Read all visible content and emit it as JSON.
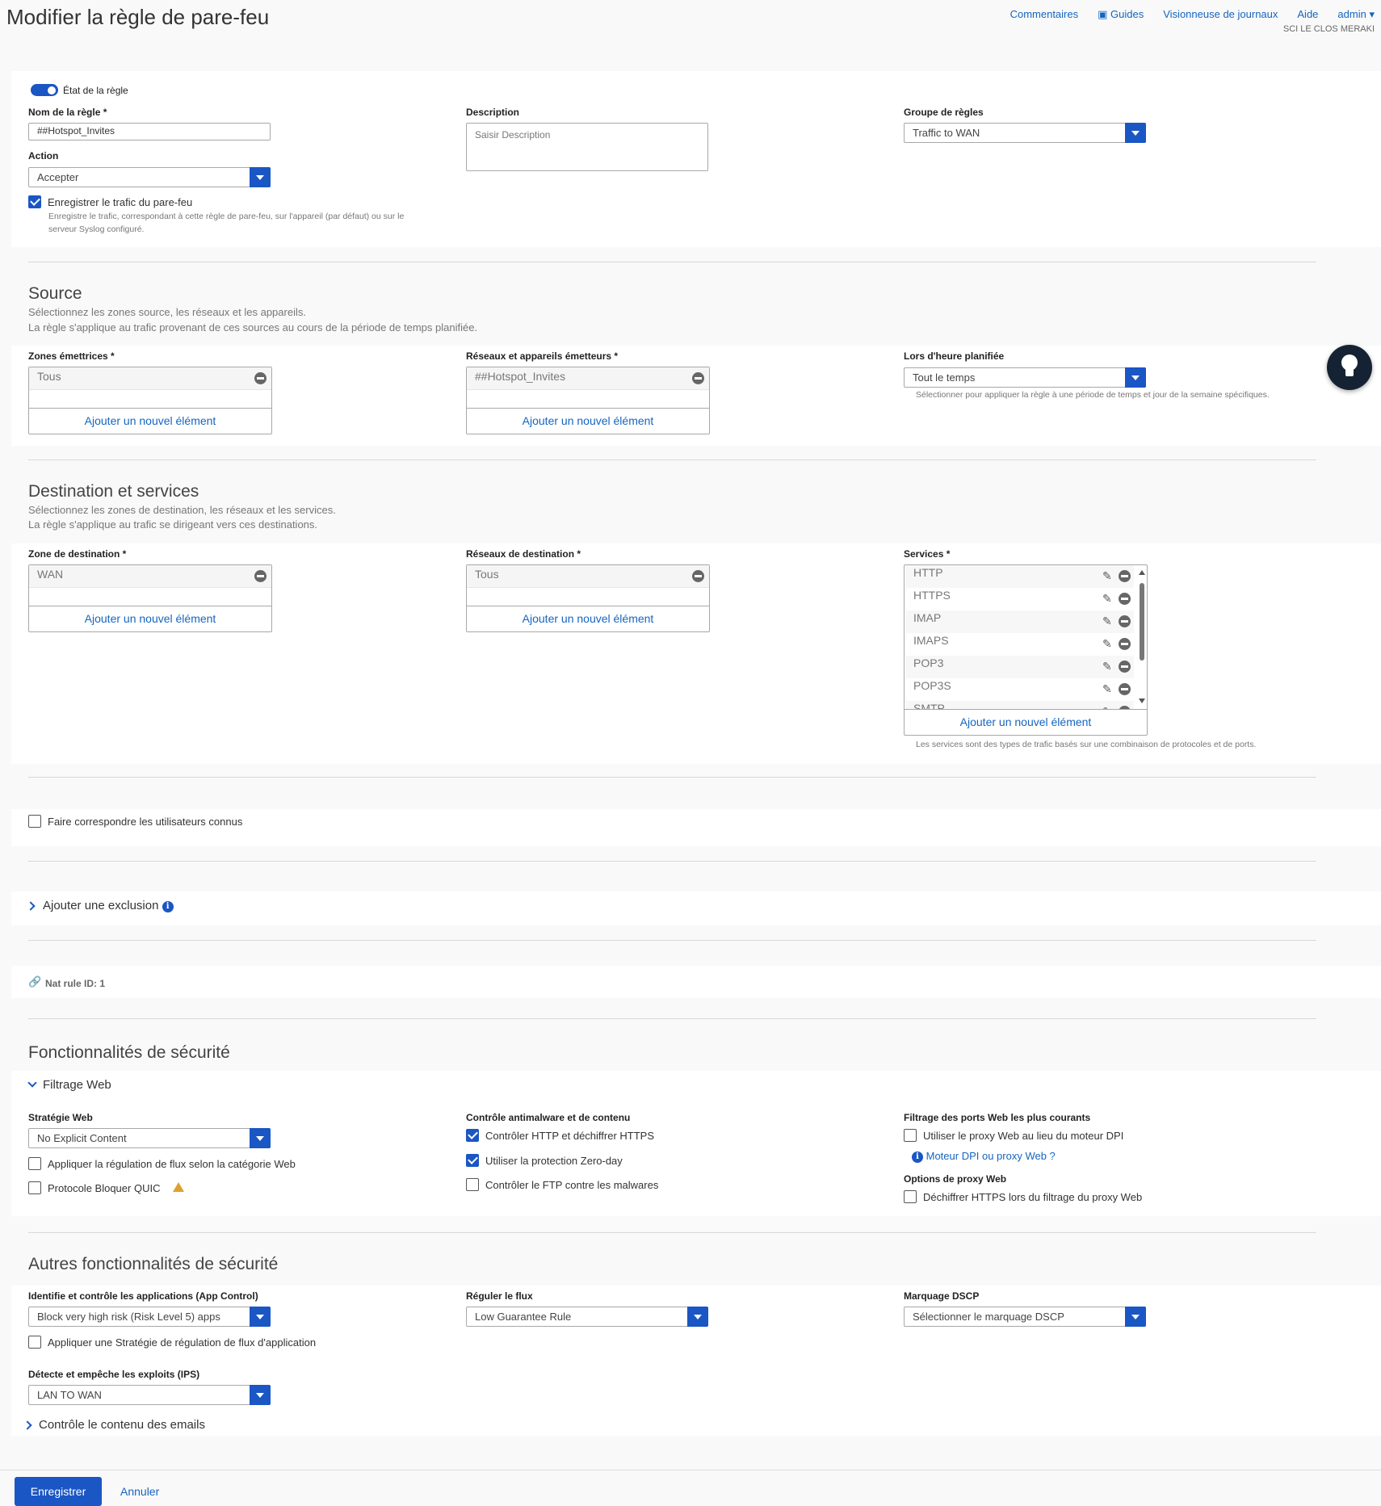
{
  "page": {
    "title": "Modifier la règle de pare-feu",
    "org": "SCI LE CLOS MERAKI"
  },
  "topnav": {
    "comments": "Commentaires",
    "guides": "Guides",
    "log_viewer": "Visionneuse de journaux",
    "help": "Aide",
    "admin": "admin"
  },
  "rule": {
    "state_label": "État de la règle",
    "state_on": true,
    "name_label": "Nom de la règle *",
    "name_value": "##Hotspot_Invites",
    "action_label": "Action",
    "action_value": "Accepter",
    "log_label": "Enregistrer le trafic du pare-feu",
    "log_checked": true,
    "log_hint_1": "Enregistre le trafic, correspondant à cette règle de pare-feu, sur l'appareil (par défaut) ou sur le",
    "log_hint_2": "serveur Syslog configuré.",
    "description_label": "Description",
    "description_placeholder": "Saisir Description",
    "group_label": "Groupe de règles",
    "group_value": "Traffic to WAN"
  },
  "source": {
    "title": "Source",
    "desc_1": "Sélectionnez les zones source, les réseaux et les appareils.",
    "desc_2": "La règle s'applique au trafic provenant de ces sources au cours de la période de temps planifiée.",
    "zones_label": "Zones émettrices *",
    "zones_item": "Tous",
    "networks_label": "Réseaux et appareils émetteurs *",
    "networks_item": "##Hotspot_Invites",
    "schedule_label": "Lors d'heure planifiée",
    "schedule_value": "Tout le temps",
    "schedule_hint": "Sélectionner pour appliquer la règle à une période de temps et jour de la semaine spécifiques.",
    "add_label": "Ajouter un nouvel élément"
  },
  "destination": {
    "title": "Destination et services",
    "desc_1": "Sélectionnez les zones de destination, les réseaux et les services.",
    "desc_2": "La règle s'applique au trafic se dirigeant vers ces destinations.",
    "zone_label": "Zone de destination *",
    "zone_item": "WAN",
    "networks_label": "Réseaux de destination *",
    "networks_item": "Tous",
    "services_label": "Services *",
    "services": [
      "HTTP",
      "HTTPS",
      "IMAP",
      "IMAPS",
      "POP3",
      "POP3S",
      "SMTP"
    ],
    "services_hint": "Les services sont des types de trafic basés sur une combinaison de protocoles et de ports.",
    "add_label": "Ajouter un nouvel élément"
  },
  "users": {
    "match_label": "Faire correspondre les utilisateurs connus",
    "match_checked": false
  },
  "exclusion": {
    "label": "Ajouter une exclusion"
  },
  "nat": {
    "label": "Nat rule ID: 1"
  },
  "security": {
    "title": "Fonctionnalités de sécurité",
    "web_filter_title": "Filtrage Web",
    "web_policy_label": "Stratégie Web",
    "web_policy_value": "No Explicit Content",
    "web_qos_label": "Appliquer la régulation de flux selon la catégorie Web",
    "web_qos_checked": false,
    "quic_label": "Protocole Bloquer QUIC",
    "quic_checked": false,
    "malware_label": "Contrôle antimalware et de contenu",
    "https_scan_label": "Contrôler HTTP et déchiffrer HTTPS",
    "https_scan_checked": true,
    "zero_day_label": "Utiliser la protection Zero-day",
    "zero_day_checked": true,
    "ftp_label": "Contrôler le FTP contre les malwares",
    "ftp_checked": false,
    "ports_label": "Filtrage des ports Web les plus courants",
    "proxy_label": "Utiliser le proxy Web au lieu du moteur DPI",
    "proxy_checked": false,
    "dpi_link": "Moteur DPI ou proxy Web ?",
    "proxy_options_label": "Options de proxy Web",
    "decrypt_label": "Déchiffrer HTTPS lors du filtrage du proxy Web",
    "decrypt_checked": false
  },
  "other_security": {
    "title": "Autres fonctionnalités de sécurité",
    "app_control_label": "Identifie et contrôle les applications (App Control)",
    "app_control_value": "Block very high risk (Risk Level 5) apps",
    "app_qos_label": "Appliquer une Stratégie de régulation de flux d'application",
    "app_qos_checked": false,
    "qos_label": "Réguler le flux",
    "qos_value": "Low Guarantee Rule",
    "dscp_label": "Marquage DSCP",
    "dscp_value": "Sélectionner le marquage DSCP",
    "ips_label": "Détecte et empêche les exploits (IPS)",
    "ips_value": "LAN TO WAN",
    "email_label": "Contrôle le contenu des emails"
  },
  "actions": {
    "save": "Enregistrer",
    "cancel": "Annuler"
  },
  "colors": {
    "accent": "#1a56c4",
    "link": "#1565c0",
    "warning": "#e0a030"
  },
  "icons": [
    "video-camera-icon",
    "chevron-down-icon",
    "minus-circle-icon",
    "pencil-icon",
    "info-icon",
    "warning-icon",
    "link-icon",
    "lightbulb-icon",
    "chevron-right-icon"
  ]
}
